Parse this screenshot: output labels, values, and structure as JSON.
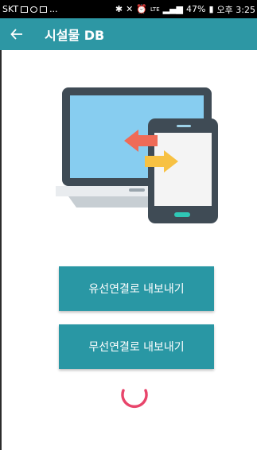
{
  "status_bar": {
    "carrier": "SKT",
    "ellipsis": "...",
    "network": "LTE",
    "battery": "47%",
    "time": "오후 3:25"
  },
  "app_bar": {
    "back_icon": "arrow-left-icon",
    "title": "시설물 DB"
  },
  "illustration": {
    "icon": "laptop-phone-transfer-icon"
  },
  "buttons": {
    "wired_export": "유선연결로 내보내기",
    "wireless_export": "무선연결로 내보내기"
  },
  "loading": {
    "icon": "loading-spinner-icon"
  },
  "colors": {
    "primary": "#2d97a4",
    "spinner": "#e8456b",
    "arrow_red": "#ef6b57",
    "arrow_yellow": "#f7c143",
    "screen_blue": "#87cdf0",
    "device_dark": "#3f4b55"
  }
}
